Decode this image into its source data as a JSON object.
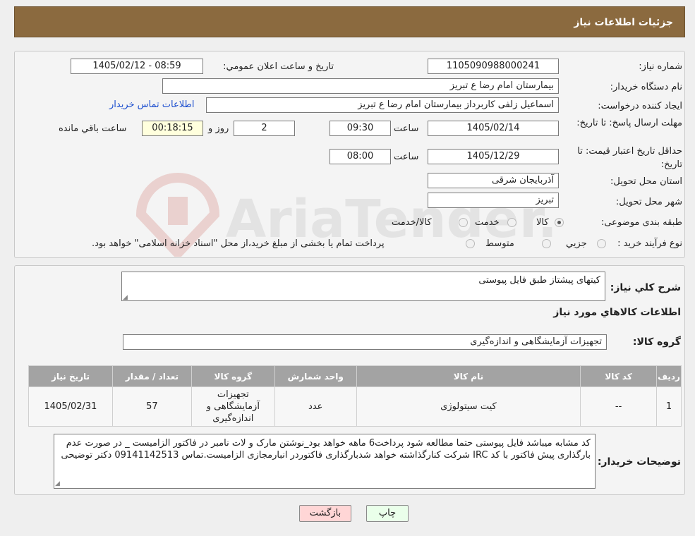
{
  "header": {
    "title": "جزئیات اطلاعات نیاز"
  },
  "form": {
    "need_number_label": "شماره نیاز:",
    "need_number": "1105090988000241",
    "announce_label": "تاریخ و ساعت اعلان عمومي:",
    "announce_value": "1405/02/12 - 08:59",
    "buyer_org_label": "نام دستگاه خریدار:",
    "buyer_org": "بیمارستان امام رضا  ع  تبریز",
    "requester_label": "ایجاد کننده درخواست:",
    "requester": "اسماعیل زلفی کاربرداز بیمارستان امام رضا  ع  تبریز",
    "contact_link": "اطلاعات تماس خریدار",
    "deadline_label": "مهلت ارسال پاسخ: تا تاریخ:",
    "deadline_date": "1405/02/14",
    "time_label": "ساعت",
    "deadline_time": "09:30",
    "days_value": "2",
    "days_label": "روز و",
    "remaining_value": "00:18:15",
    "remaining_label": "ساعت باقي مانده",
    "validity_label": "حداقل تاریخ اعتبار قیمت: تا تاریخ:",
    "validity_date": "1405/12/29",
    "validity_time": "08:00",
    "province_label": "استان محل تحویل:",
    "province": "آذربایجان شرقی",
    "city_label": "شهر محل تحویل:",
    "city": "تبریز",
    "category_label": "طبقه بندی موضوعی:",
    "category_options": [
      "کالا",
      "خدمت",
      "کالا/خدمت"
    ],
    "process_label": "نوع فرآیند خرید :",
    "process_options": [
      "جزیي",
      "متوسط"
    ],
    "process_note": "پرداخت تمام یا بخشی از مبلغ خرید،از محل \"اسناد خزانه اسلامی\" خواهد بود."
  },
  "detail": {
    "summary_label": "شرح کلي نیاز:",
    "summary": "کیتهای پیشتاز طبق فایل پیوستی",
    "items_title": "اطلاعات کالاهاي مورد نیاز",
    "group_label": "گروه کالا:",
    "group_value": "تجهیزات آزمایشگاهی و اندازه‌گیری",
    "table": {
      "headers": [
        "ردیف",
        "کد کالا",
        "نام کالا",
        "واحد شمارش",
        "گروه کالا",
        "تعداد / مقدار",
        "تاریخ نیاز"
      ],
      "rows": [
        [
          "1",
          "--",
          "کیت سیتولوژی",
          "عدد",
          "تجهیزات آزمایشگاهی و اندازه‌گیری",
          "57",
          "1405/02/31"
        ]
      ]
    },
    "notes_label": "توضیحات خریدار:",
    "notes": "کد مشابه میباشد فایل پیوستی حتما مطالعه شود  پرداخت6 ماهه خواهد بود_نوشتن مارک و لات نامبر در فاکتور الزامیست _  در صورت عدم بارگذاری پیش فاکتور با کد IRC  شرکت کنارگذاشته خواهد شدبارگذاری فاکتوردر انبارمجازی الزامیست.تماس 09141142513 دکتر توضیحی"
  },
  "buttons": {
    "print": "چاپ",
    "back": "بازگشت"
  },
  "watermark": {
    "brand": "AriaTender.neT"
  },
  "colors": {
    "header_bg": "#8b6a3f",
    "back_btn": "#ffd6d6",
    "print_btn": "#eaffea",
    "link": "#1d4fcf"
  }
}
